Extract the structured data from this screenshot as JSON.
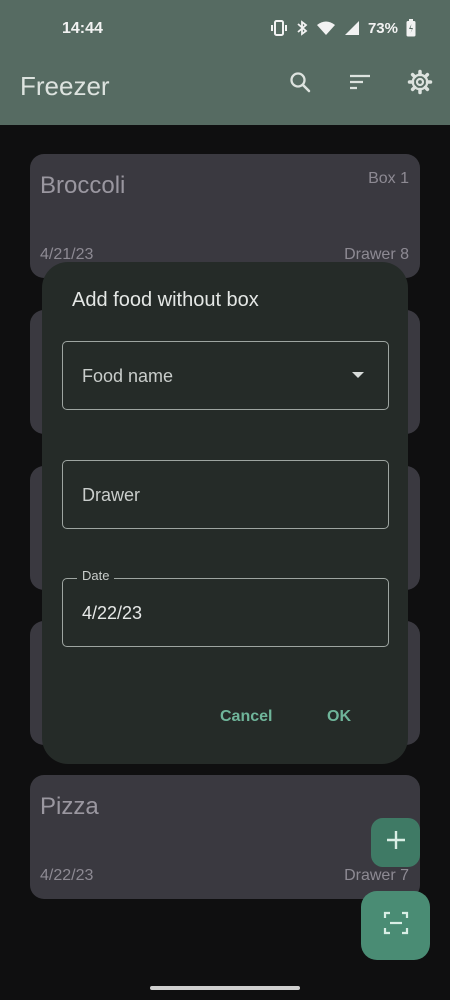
{
  "status": {
    "time": "14:44",
    "battery": "73%",
    "icons": [
      "vibrate-icon",
      "bluetooth-icon",
      "wifi-icon",
      "signal-icon",
      "battery-icon"
    ]
  },
  "appbar": {
    "title": "Freezer",
    "actions": [
      "search-icon",
      "sort-icon",
      "settings-icon"
    ]
  },
  "cards": [
    {
      "name": "Broccoli",
      "box": "Box 1",
      "date": "4/21/23",
      "drawer": "Drawer 8"
    },
    {
      "name": "Pizza",
      "box": "",
      "date": "4/22/23",
      "drawer": "Drawer 7"
    }
  ],
  "dialog": {
    "title": "Add food without box",
    "food_name_placeholder": "Food name",
    "drawer_placeholder": "Drawer",
    "date_label": "Date",
    "date_value": "4/22/23",
    "cancel_label": "Cancel",
    "ok_label": "OK"
  },
  "fabs": [
    "add-icon",
    "scan-icon"
  ],
  "colors": {
    "appbar": "#566b62",
    "card": "#3a3940",
    "dialog": "#252b28",
    "accent": "#6fb59a",
    "fab": "#4a8c74"
  }
}
